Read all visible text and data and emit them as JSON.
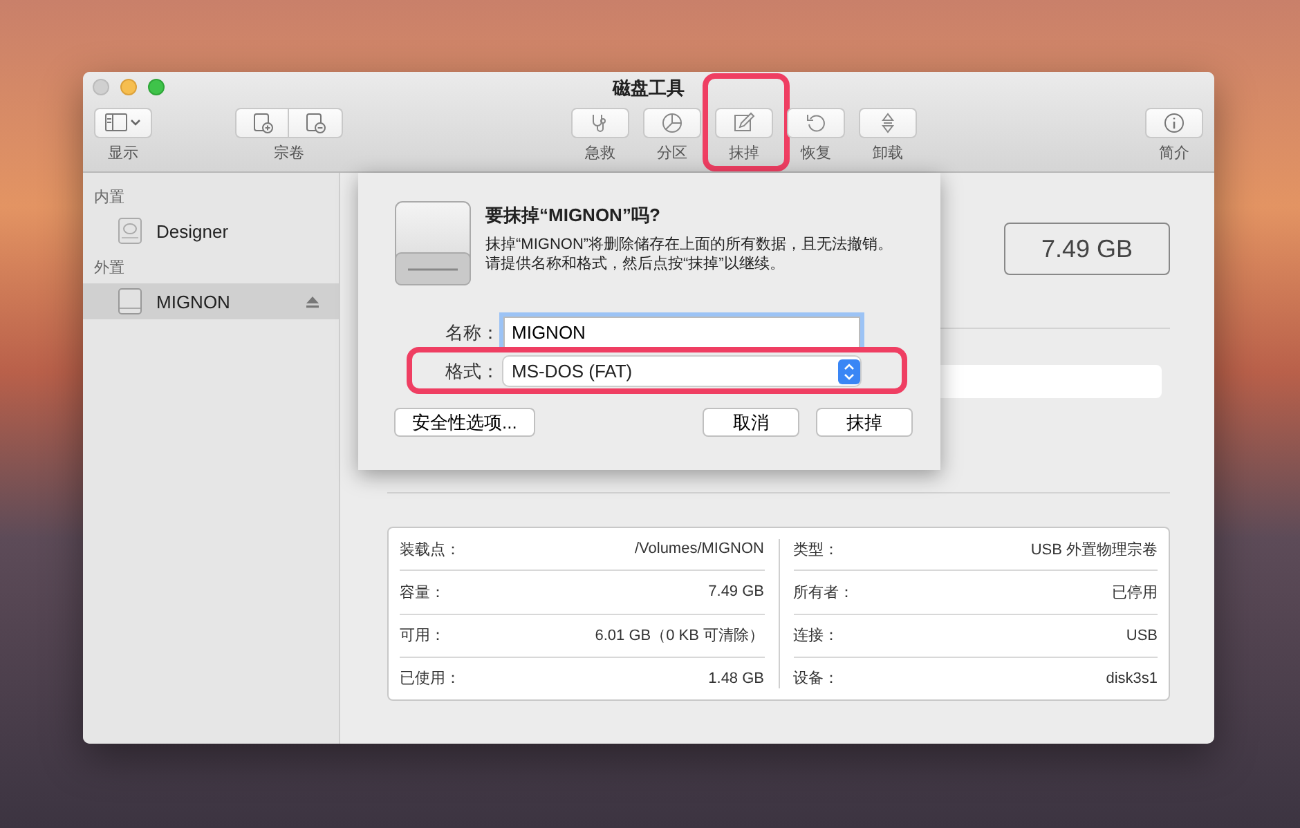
{
  "window": {
    "title": "磁盘工具"
  },
  "toolbar": [
    {
      "kind": "view",
      "label": "显示",
      "highlighted": false
    },
    {
      "kind": "volume",
      "label": "宗卷",
      "highlighted": false
    },
    {
      "kind": "firstaid",
      "label": "急救",
      "highlighted": false
    },
    {
      "kind": "partition",
      "label": "分区",
      "highlighted": false
    },
    {
      "kind": "erase",
      "label": "抹掉",
      "highlighted": true
    },
    {
      "kind": "restore",
      "label": "恢复",
      "highlighted": false
    },
    {
      "kind": "unmount",
      "label": "卸载",
      "highlighted": false
    },
    {
      "kind": "info",
      "label": "简介",
      "highlighted": false
    }
  ],
  "sidebar": {
    "sections": [
      {
        "title": "内置",
        "items": [
          {
            "label": "Designer",
            "kind": "internal",
            "selected": false,
            "ejectable": false
          }
        ]
      },
      {
        "title": "外置",
        "items": [
          {
            "label": "MIGNON",
            "kind": "external",
            "selected": true,
            "ejectable": true
          }
        ]
      }
    ]
  },
  "capacity": "7.49 GB",
  "sheet": {
    "title": "要抹掉“MIGNON”吗?",
    "message_lines": [
      "抹掉“MIGNON”将删除储存在上面的所有数据，且无法撤销。",
      "请提供名称和格式，然后点按“抹掉”以继续。"
    ],
    "name_label": "名称：",
    "name_value": "MIGNON",
    "name_focused": true,
    "format_label": "格式：",
    "format_value": "MS-DOS (FAT)",
    "format_highlighted": true,
    "buttons": [
      {
        "kind": "security",
        "label": "安全性选项..."
      },
      {
        "kind": "cancel",
        "label": "取消"
      },
      {
        "kind": "erase",
        "label": "抹掉"
      }
    ]
  },
  "info": {
    "left": [
      {
        "label": "装载点：",
        "value": "/Volumes/MIGNON"
      },
      {
        "label": "容量：",
        "value": "7.49 GB"
      },
      {
        "label": "可用：",
        "value": "6.01 GB（0 KB 可清除）"
      },
      {
        "label": "已使用：",
        "value": "1.48 GB"
      }
    ],
    "right": [
      {
        "label": "类型：",
        "value": "USB 外置物理宗卷"
      },
      {
        "label": "所有者：",
        "value": "已停用"
      },
      {
        "label": "连接：",
        "value": "USB"
      },
      {
        "label": "设备：",
        "value": "disk3s1"
      }
    ]
  }
}
